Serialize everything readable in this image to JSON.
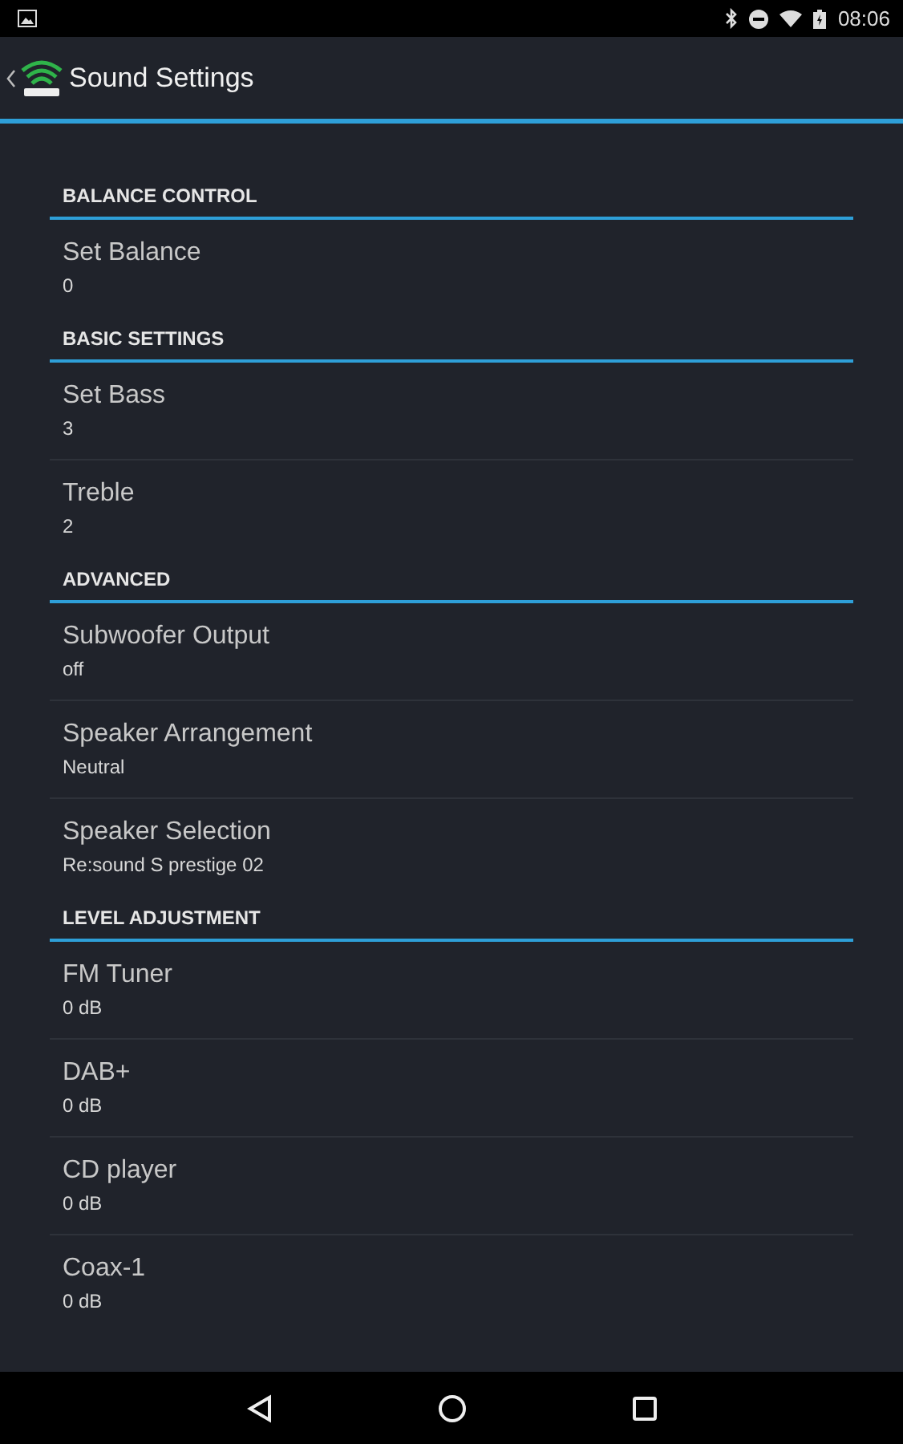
{
  "status_bar": {
    "time": "08:06"
  },
  "action_bar": {
    "title": "Sound Settings"
  },
  "sections": [
    {
      "title": "BALANCE CONTROL",
      "items": [
        {
          "title": "Set Balance",
          "summary": "0"
        }
      ]
    },
    {
      "title": "BASIC SETTINGS",
      "items": [
        {
          "title": "Set Bass",
          "summary": "3"
        },
        {
          "title": "Treble",
          "summary": "2"
        }
      ]
    },
    {
      "title": "ADVANCED",
      "items": [
        {
          "title": "Subwoofer Output",
          "summary": "off"
        },
        {
          "title": "Speaker Arrangement",
          "summary": "Neutral"
        },
        {
          "title": "Speaker Selection",
          "summary": "Re:sound S prestige 02"
        }
      ]
    },
    {
      "title": "LEVEL ADJUSTMENT",
      "items": [
        {
          "title": "FM Tuner",
          "summary": "0 dB"
        },
        {
          "title": "DAB+",
          "summary": "0 dB"
        },
        {
          "title": "CD player",
          "summary": "0 dB"
        },
        {
          "title": "Coax-1",
          "summary": "0 dB"
        }
      ]
    }
  ]
}
